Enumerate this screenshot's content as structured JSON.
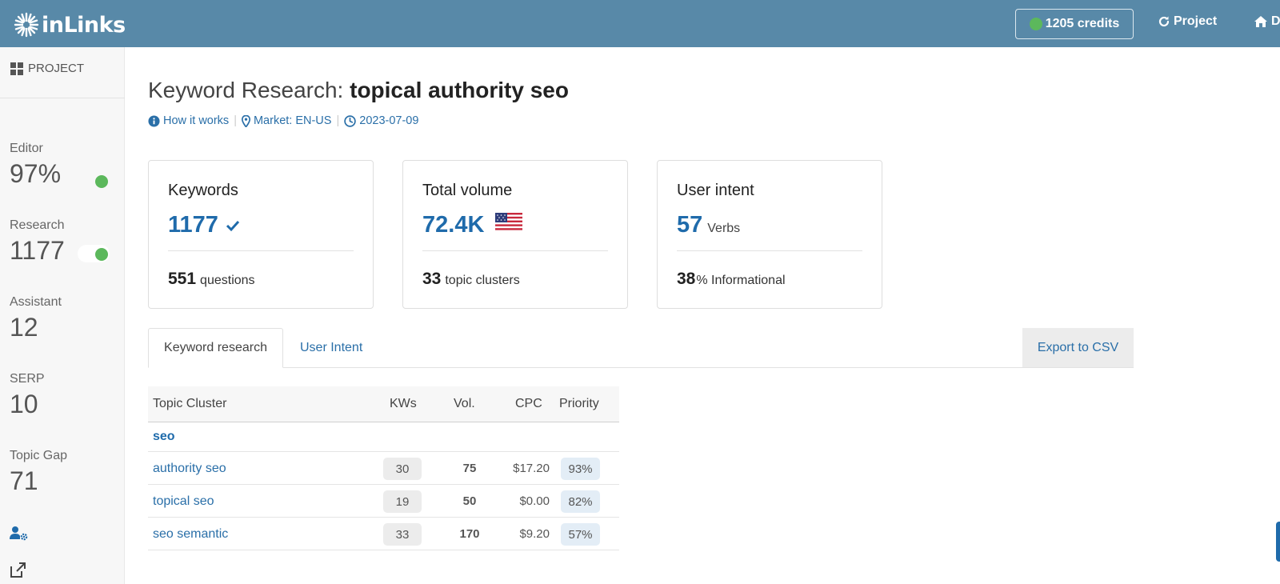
{
  "header": {
    "logo_text": "inLinks",
    "credits_label": "1205 credits",
    "nav": [
      {
        "label": "Project",
        "icon": "refresh-icon"
      },
      {
        "label": "D",
        "icon": "home-icon"
      }
    ]
  },
  "sidebar": {
    "project_label": "PROJECT",
    "stats": [
      {
        "label": "Editor",
        "value": "97%"
      },
      {
        "label": "Research",
        "value": "1177"
      },
      {
        "label": "Assistant",
        "value": "12"
      },
      {
        "label": "SERP",
        "value": "10"
      },
      {
        "label": "Topic Gap",
        "value": "71"
      }
    ],
    "icons": [
      "user-settings-icon",
      "external-link-icon"
    ]
  },
  "page": {
    "title_prefix": "Keyword Research:",
    "title_keyword": "topical authority seo",
    "meta": {
      "how_it_works": "How it works",
      "market": "Market: EN-US",
      "date": "2023-07-09"
    }
  },
  "cards": [
    {
      "title": "Keywords",
      "big": "1177",
      "unit": "",
      "foot_num": "551",
      "foot_text": "questions"
    },
    {
      "title": "Total volume",
      "big": "72.4K",
      "unit": "🇺🇸",
      "foot_num": "33",
      "foot_text": "topic clusters"
    },
    {
      "title": "User intent",
      "big": "57",
      "unit": "Verbs",
      "foot_num": "38",
      "foot_text": "% Informational"
    }
  ],
  "tabs": {
    "items": [
      "Keyword research",
      "User Intent"
    ],
    "active": "Keyword research",
    "export_label": "Export to CSV"
  },
  "table": {
    "headers": [
      "Topic Cluster",
      "KWs",
      "Vol.",
      "CPC",
      "Priority"
    ],
    "group": "seo",
    "rows": [
      {
        "cluster": "authority seo",
        "kws": "30",
        "vol": "75",
        "cpc": "$17.20",
        "priority": "93%"
      },
      {
        "cluster": "topical seo",
        "kws": "19",
        "vol": "50",
        "cpc": "$0.00",
        "priority": "82%"
      },
      {
        "cluster": "seo semantic",
        "kws": "33",
        "vol": "170",
        "cpc": "$9.20",
        "priority": "57%"
      }
    ]
  },
  "colors": {
    "header_bg": "#5889a8",
    "accent_blue": "#1f6bab",
    "status_green": "#5cb85c",
    "sidebar_bg": "#f7f7f7"
  }
}
